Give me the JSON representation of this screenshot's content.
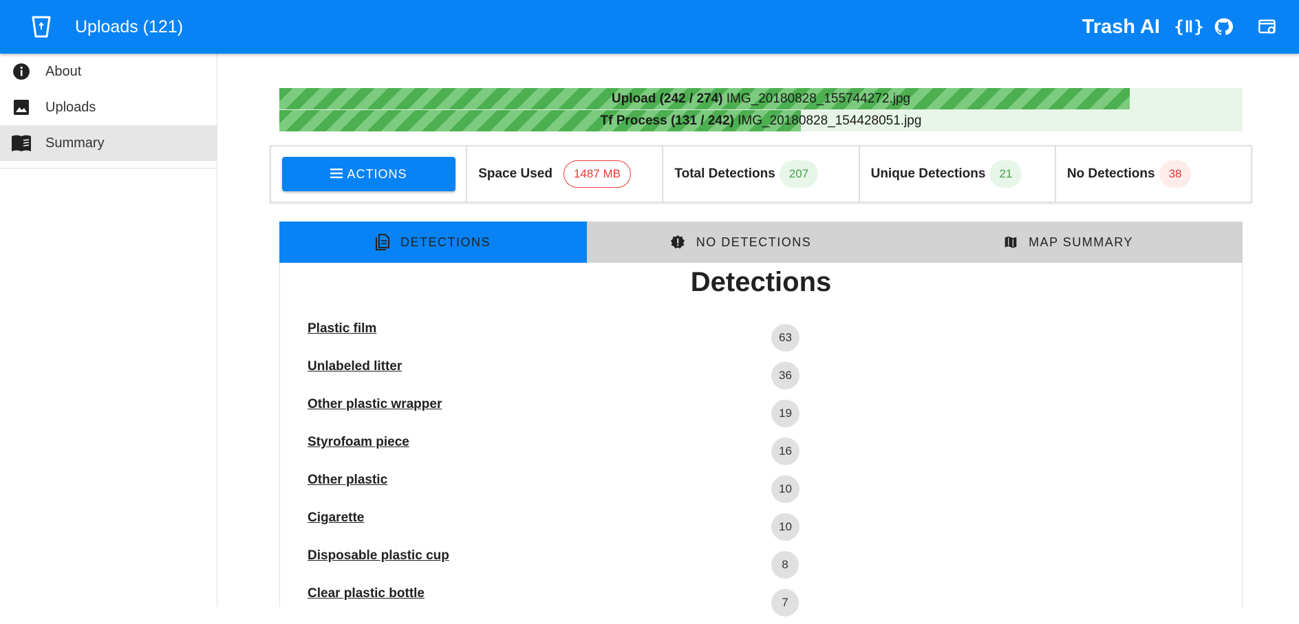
{
  "appbar": {
    "title": "Uploads (121)",
    "brand": "Trash AI",
    "icons": [
      "app-logo-icon",
      "api-braces-icon",
      "github-icon",
      "settings-app-icon"
    ],
    "api_icon_text": "{ǁ}"
  },
  "drawer": {
    "items": [
      {
        "label": "About",
        "icon": "info-icon",
        "active": false
      },
      {
        "label": "Uploads",
        "icon": "image-icon",
        "active": false
      },
      {
        "label": "Summary",
        "icon": "book-icon",
        "active": true
      }
    ]
  },
  "progress": {
    "upload": {
      "label": "Upload",
      "counts": "(242 / 274)",
      "file": "IMG_20180828_155744272.jpg",
      "fraction": 0.8832
    },
    "tf": {
      "label": "Tf Process",
      "counts": "(131 / 242)",
      "file": "IMG_20180828_154428051.jpg",
      "fraction": 0.5413
    }
  },
  "stats": {
    "actions_label": "ACTIONS",
    "space_used_label": "Space Used",
    "space_used_value": "1487 MB",
    "total_label": "Total Detections",
    "total_value": "207",
    "unique_label": "Unique Detections",
    "unique_value": "21",
    "none_label": "No Detections",
    "none_value": "38"
  },
  "tabs": [
    {
      "label": "DETECTIONS",
      "icon": "document-icon",
      "active": true
    },
    {
      "label": "NO DETECTIONS",
      "icon": "alert-badge-icon",
      "active": false
    },
    {
      "label": "MAP SUMMARY",
      "icon": "map-icon",
      "active": false
    }
  ],
  "detections": {
    "heading": "Detections",
    "items": [
      {
        "name": "Plastic film",
        "count": "63"
      },
      {
        "name": "Unlabeled litter",
        "count": "36"
      },
      {
        "name": "Other plastic wrapper",
        "count": "19"
      },
      {
        "name": "Styrofoam piece",
        "count": "16"
      },
      {
        "name": "Other plastic",
        "count": "10"
      },
      {
        "name": "Cigarette",
        "count": "10"
      },
      {
        "name": "Disposable plastic cup",
        "count": "8"
      },
      {
        "name": "Clear plastic bottle",
        "count": "7"
      }
    ]
  },
  "colors": {
    "primary": "#0783f6",
    "progress_green": "#4caf50",
    "chip_green": "#43a047",
    "chip_red": "#e53935"
  }
}
